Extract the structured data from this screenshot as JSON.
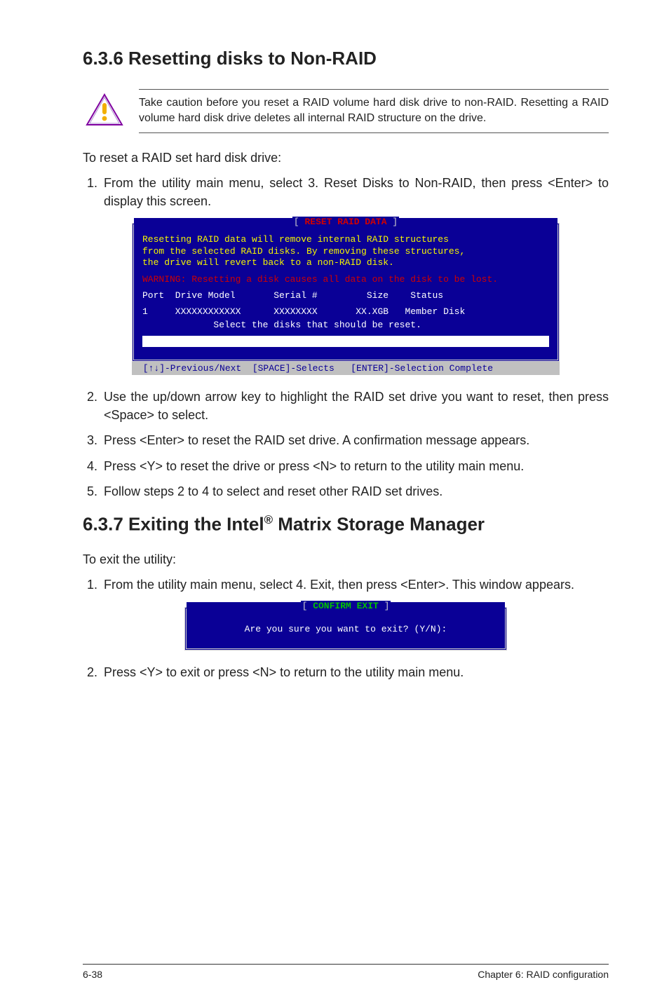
{
  "section636": {
    "heading": "6.3.6 Resetting disks to Non-RAID",
    "callout": "Take caution before you reset a RAID volume hard disk drive to non-RAID. Resetting a RAID volume hard disk drive deletes all internal RAID structure on the drive.",
    "intro": "To reset a RAID set hard disk drive:",
    "step1": "From the utility main menu, select 3. Reset Disks to Non-RAID, then press <Enter> to display this screen.",
    "step2": "Use the up/down arrow key to highlight the RAID set drive you want to reset, then press <Space> to select.",
    "step3": "Press <Enter> to reset the RAID set drive. A confirmation message appears.",
    "step4": "Press <Y> to reset the drive or press <N> to return to the utility main menu.",
    "step5": "Follow steps 2 to 4 to select and reset other RAID set drives."
  },
  "bios_reset": {
    "title_bracket_open": "[ ",
    "title_text": "RESET RAID DATA",
    "title_bracket_close": " ]",
    "msg_line1": "Resetting RAID data will remove internal RAID structures",
    "msg_line2": "from the selected RAID disks. By removing these structures,",
    "msg_line3": "the drive will revert back to a non-RAID disk.",
    "warning": "WARNING: Resetting a disk causes all data on the disk to be lost.",
    "header_row": "Port  Drive Model       Serial #         Size    Status",
    "data_row": "1     XXXXXXXXXXXX      XXXXXXXX       XX.XGB   Member Disk",
    "hint_row": "             Select the disks that should be reset.",
    "footer": " [↑↓]-Previous/Next  [SPACE]-Selects   [ENTER]-Selection Complete"
  },
  "section637": {
    "heading_a": "6.3.7 Exiting the Intel",
    "heading_sup": "®",
    "heading_b": " Matrix Storage Manager",
    "intro": "To exit the utility:",
    "step1": "From the utility main menu, select 4. Exit, then press <Enter>. This window appears.",
    "step2": "Press <Y> to exit or press <N> to return to the utility main menu."
  },
  "bios_exit": {
    "title_bracket_open": "[ ",
    "title_text": "CONFIRM EXIT",
    "title_bracket_close": " ]",
    "body": "Are you sure you want to exit? (Y/N):"
  },
  "footer": {
    "left": "6-38",
    "right": "Chapter 6: RAID configuration"
  }
}
